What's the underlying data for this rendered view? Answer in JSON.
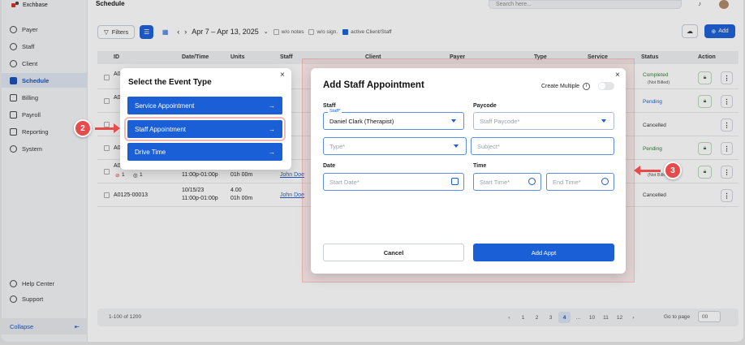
{
  "app": {
    "name": "Exchbase",
    "page_title": "Schedule",
    "search_placeholder": "Search here..."
  },
  "sidebar": {
    "items": [
      {
        "label": "Payer"
      },
      {
        "label": "Staff"
      },
      {
        "label": "Client"
      },
      {
        "label": "Schedule"
      },
      {
        "label": "Billing"
      },
      {
        "label": "Payroll"
      },
      {
        "label": "Reporting"
      },
      {
        "label": "System"
      }
    ],
    "active": "Schedule",
    "help_center": "Help Center",
    "support": "Support",
    "collapse": "Collapse"
  },
  "toolbar": {
    "filters": "Filters",
    "date_range": "Apr 7 – Apr 13, 2025",
    "wo_notes": "w/o notes",
    "wo_sign": "w/o sign.",
    "active_client_staff": "active Client/Staff",
    "add": "Add"
  },
  "table": {
    "headers": [
      "ID",
      "Date/Time",
      "Units",
      "Staff",
      "Client",
      "Payer",
      "Type",
      "Service",
      "Status",
      "Action"
    ],
    "rows": [
      {
        "id": "A0",
        "status": "Completed",
        "status_sub": "(Not Billed)"
      },
      {
        "id": "A0",
        "status": "Pending"
      },
      {
        "id": "",
        "status": "Cancelled"
      },
      {
        "id": "A0",
        "status": "Pending"
      },
      {
        "id": "A0",
        "time": "11:00p-01:00p",
        "units": "01h 00m",
        "staff": "John Doe",
        "status_sub": "(Not Billed)",
        "alerts": [
          "1",
          "1"
        ]
      },
      {
        "id": "A0125-00013",
        "date": "10/15/23",
        "time": "11:00p-01:00p",
        "units": "4.00",
        "units_sub": "01h 00m",
        "staff": "John Doe",
        "status": "Cancelled"
      }
    ]
  },
  "footer": {
    "count": "1-100 of 1200",
    "pages": [
      "1",
      "2",
      "3",
      "4",
      "...",
      "10",
      "11",
      "12"
    ],
    "current_page": "4",
    "goto": "Go to page",
    "goto_value": "00"
  },
  "event_modal": {
    "title": "Select the Event Type",
    "options": [
      "Service Appointment",
      "Staff Appointment",
      "Drive Time"
    ],
    "selected": "Staff Appointment"
  },
  "appt_modal": {
    "title": "Add Staff Appointment",
    "create_multiple": "Create Multiple",
    "staff_label": "Staff",
    "staff_float": "Staff*",
    "staff_value": "Daniel Clark (Therapist)",
    "paycode_label": "Paycode",
    "paycode_placeholder": "Staff Paycode*",
    "type_placeholder": "Type*",
    "subject_placeholder": "Subject*",
    "date_label": "Date",
    "start_date_placeholder": "Start Date*",
    "time_label": "Time",
    "start_time_placeholder": "Start Time*",
    "end_time_placeholder": "End Time*",
    "cancel": "Cancel",
    "submit": "Add Appt"
  },
  "annotations": {
    "step2": "2",
    "step3": "3"
  },
  "colors": {
    "primary": "#1a5fd6",
    "annotation": "#e74c4c",
    "completed": "#2e7d32"
  }
}
